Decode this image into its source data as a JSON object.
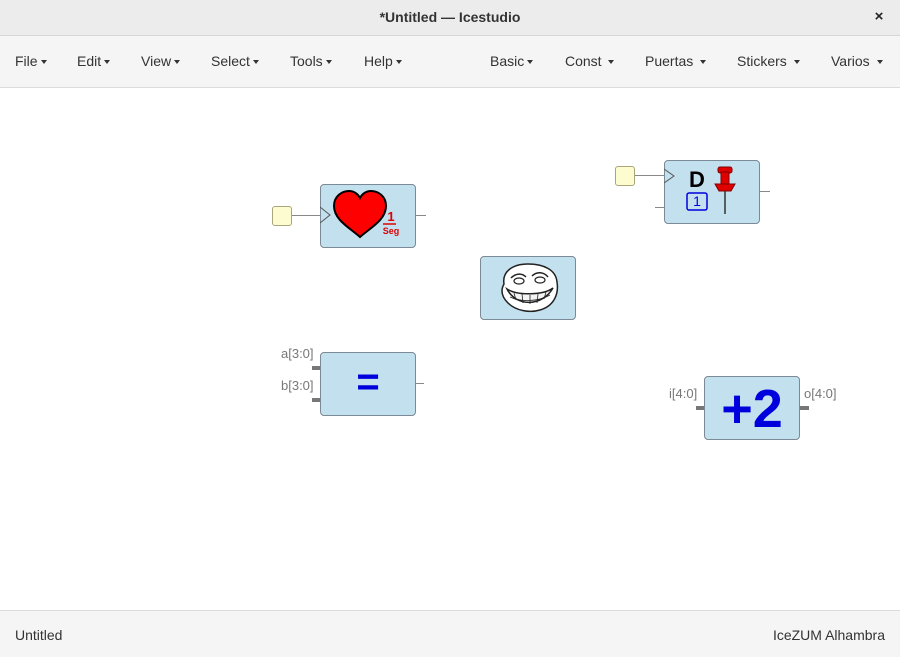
{
  "window": {
    "title": "*Untitled — Icestudio",
    "close_glyph": "×"
  },
  "menubar": {
    "left": [
      {
        "label": "File"
      },
      {
        "label": "Edit"
      },
      {
        "label": "View"
      },
      {
        "label": "Select"
      },
      {
        "label": "Tools"
      },
      {
        "label": "Help"
      }
    ],
    "right": [
      {
        "label": "Basic"
      },
      {
        "label": "Const "
      },
      {
        "label": "Puertas "
      },
      {
        "label": "Stickers "
      },
      {
        "label": "Varios "
      }
    ]
  },
  "blocks": {
    "heart": {
      "icon": "heart-icon",
      "number": "1",
      "unit": "Seg",
      "color": "#ff0000"
    },
    "dff": {
      "letter": "D",
      "init_value": "1",
      "icon": "pushpin-icon"
    },
    "troll": {
      "icon": "troll-face-icon"
    },
    "comparator": {
      "symbol": "=",
      "inputs": [
        "a[3:0]",
        "b[3:0]"
      ]
    },
    "adder": {
      "symbol": "+2",
      "input": "i[4:0]",
      "output": "o[4:0]"
    }
  },
  "statusbar": {
    "file": "Untitled",
    "board": "IceZUM Alhambra"
  },
  "colors": {
    "block_fill": "#c3e0ee",
    "input_port": "#fcfcd0",
    "accent_blue": "#0000dd",
    "pin_red": "#e00000"
  }
}
